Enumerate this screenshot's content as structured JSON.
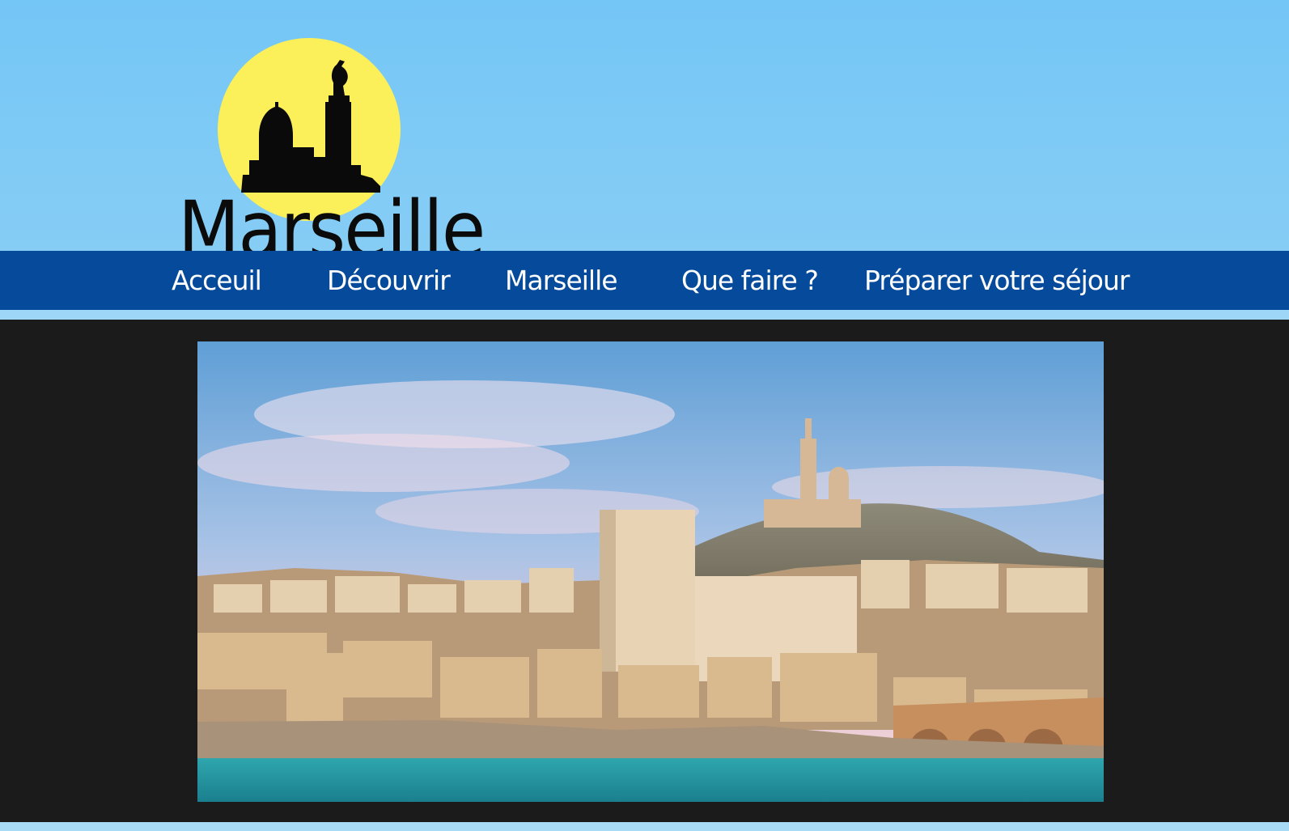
{
  "site": {
    "logo_text": "Marseille"
  },
  "nav": {
    "items": [
      {
        "label": "Acceuil"
      },
      {
        "label": "Découvrir"
      },
      {
        "label": "Marseille"
      },
      {
        "label": "Que faire ?"
      },
      {
        "label": "Préparer votre séjour"
      }
    ]
  },
  "colors": {
    "sky": "#7cc8f5",
    "nav_bg": "#054a9b",
    "content_bg": "#1b1b1b",
    "sun": "#fbef5a"
  },
  "hero": {
    "image": "marseille-panorama-image"
  }
}
